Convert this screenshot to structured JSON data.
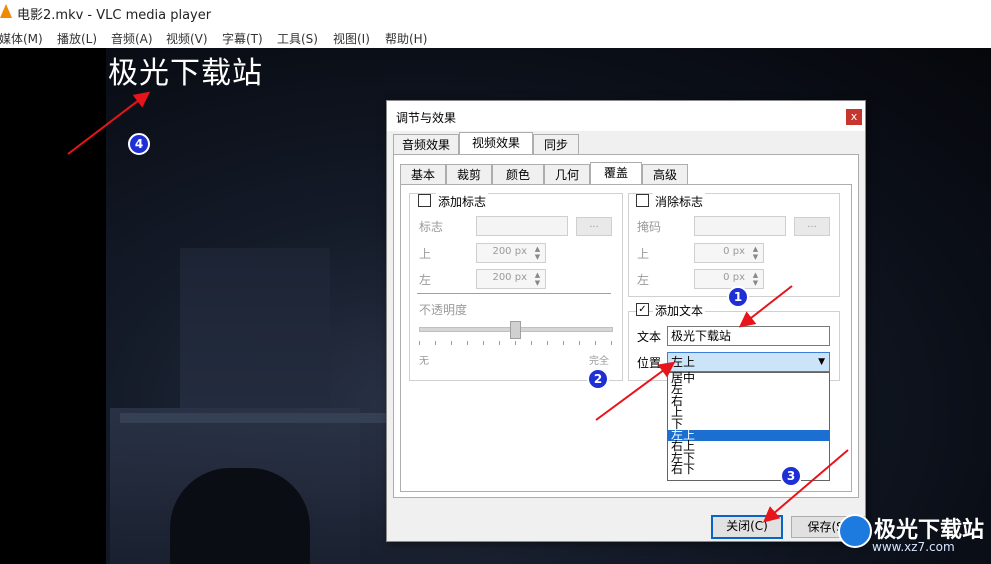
{
  "window": {
    "title": "电影2.mkv - VLC media player"
  },
  "menu": [
    "媒体(M)",
    "播放(L)",
    "音频(A)",
    "视频(V)",
    "字幕(T)",
    "工具(S)",
    "视图(I)",
    "帮助(H)"
  ],
  "video": {
    "overlay_text": "极光下载站"
  },
  "annotations": [
    "1",
    "2",
    "3",
    "4"
  ],
  "dialog": {
    "title": "调节与效果",
    "close_glyph": "x",
    "main_tabs": [
      "音频效果",
      "视频效果",
      "同步"
    ],
    "sub_tabs": [
      "基本",
      "裁剪",
      "颜色",
      "几何",
      "覆盖",
      "高级"
    ],
    "add_logo": {
      "label": "添加标志",
      "logo_label": "标志",
      "top_label": "上",
      "left_label": "左",
      "top_value": "200",
      "left_value": "200",
      "unit": "px",
      "browse": "...",
      "opacity_label": "不透明度",
      "opacity_min": "无",
      "opacity_max": "完全",
      "opacity_level": 0.5
    },
    "remove_logo": {
      "label": "消除标志",
      "mask_label": "掩码",
      "top_label": "上",
      "left_label": "左",
      "top_value": "0",
      "left_value": "0",
      "unit": "px",
      "browse": "..."
    },
    "add_text": {
      "label": "添加文本",
      "checked": true,
      "text_label": "文本",
      "text_value": "极光下载站",
      "position_label": "位置",
      "position_value": "左上",
      "position_options": [
        "居中",
        "左",
        "右",
        "上",
        "下",
        "左上",
        "右上",
        "左下",
        "右下"
      ],
      "selected_index": 5
    },
    "buttons": {
      "close": "关闭(C)",
      "save": "保存(S)"
    }
  },
  "watermark": {
    "brand": "极光下载站",
    "url": "www.xz7.com"
  },
  "colors": {
    "badge": "#1e2fd6",
    "arrow": "#e8141b",
    "selection": "#1a6fd0",
    "vlc_orange": "#f08a00"
  }
}
